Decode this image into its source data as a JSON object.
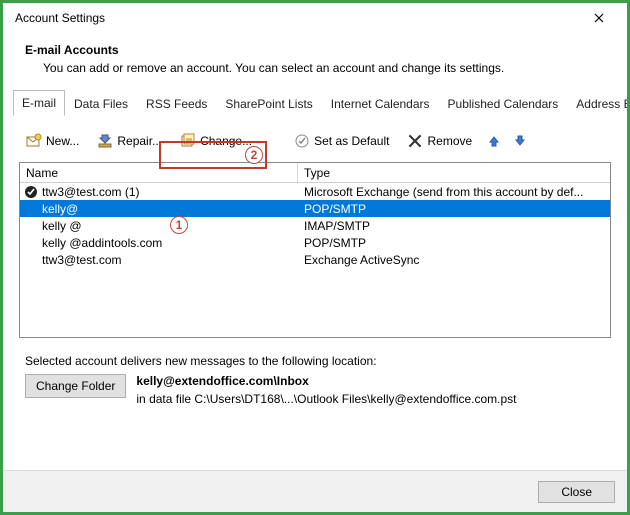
{
  "window": {
    "title": "Account Settings"
  },
  "header": {
    "title": "E-mail Accounts",
    "description": "You can add or remove an account. You can select an account and change its settings."
  },
  "tabs": [
    {
      "label": "E-mail",
      "active": true
    },
    {
      "label": "Data Files"
    },
    {
      "label": "RSS Feeds"
    },
    {
      "label": "SharePoint Lists"
    },
    {
      "label": "Internet Calendars"
    },
    {
      "label": "Published Calendars"
    },
    {
      "label": "Address Books"
    }
  ],
  "toolbar": {
    "new_label": "New...",
    "repair_label": "Repair...",
    "change_label": "Change...",
    "default_label": "Set as Default",
    "remove_label": "Remove"
  },
  "columns": {
    "name": "Name",
    "type": "Type"
  },
  "accounts": [
    {
      "name": "ttw3@test.com (1)",
      "type": "Microsoft Exchange (send from this account by def...",
      "default": true,
      "selected": false
    },
    {
      "name": "kelly@",
      "type": "POP/SMTP",
      "default": false,
      "selected": true
    },
    {
      "name": "kelly          @",
      "type": "IMAP/SMTP",
      "default": false,
      "selected": false
    },
    {
      "name": "kelly       @addintools.com",
      "type": "POP/SMTP",
      "default": false,
      "selected": false
    },
    {
      "name": "ttw3@test.com",
      "type": "Exchange ActiveSync",
      "default": false,
      "selected": false
    }
  ],
  "footer": {
    "intro": "Selected account delivers new messages to the following location:",
    "change_folder_label": "Change Folder",
    "location_main": "kelly@extendoffice.com\\Inbox",
    "location_sub": "in data file C:\\Users\\DT168\\...\\Outlook Files\\kelly@extendoffice.com.pst"
  },
  "buttons": {
    "close": "Close"
  },
  "annotations": {
    "badge1": "1",
    "badge2": "2"
  }
}
